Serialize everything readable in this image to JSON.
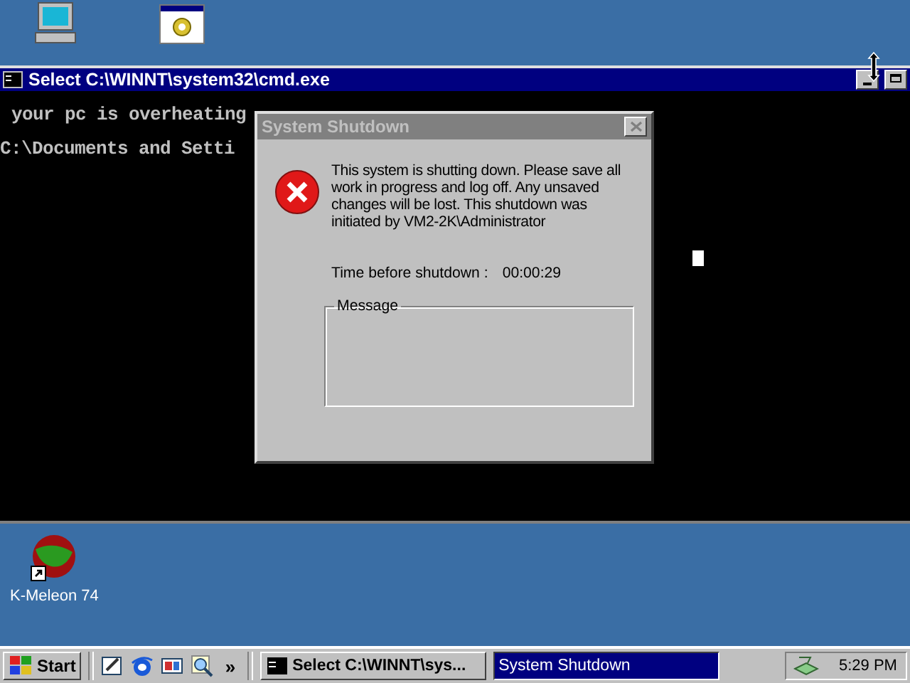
{
  "console_window": {
    "title": "Select C:\\WINNT\\system32\\cmd.exe",
    "lines": [
      "your pc is overheating",
      "C:\\Documents and Setti"
    ]
  },
  "dialog": {
    "title": "System Shutdown",
    "message": "This system is shutting down. Please save all work in progress and log off. Any unsaved changes will be lost. This shutdown was initiated by VM2-2K\\Administrator",
    "time_label": "Time before shutdown :",
    "time_value": "00:00:29",
    "group_label": "Message"
  },
  "desktop_shortcut": {
    "label": "K-Meleon 74"
  },
  "taskbar": {
    "start": "Start",
    "chevron": "»",
    "tasks": [
      {
        "label": "Select C:\\WINNT\\sys...",
        "selected": false,
        "kind": "console"
      },
      {
        "label": "System Shutdown",
        "selected": true,
        "kind": "dialog"
      }
    ],
    "clock": "5:29 PM"
  }
}
